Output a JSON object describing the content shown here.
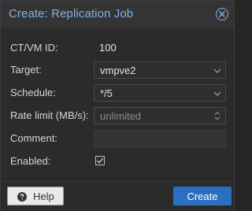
{
  "dialog": {
    "title": "Create: Replication Job",
    "close_icon": "close-circle-icon",
    "accent_color": "#7fb2e6"
  },
  "form": {
    "vmid": {
      "label": "CT/VM ID:",
      "value": "100"
    },
    "target": {
      "label": "Target:",
      "value": "vmpve2",
      "icon": "chevron-down-icon"
    },
    "schedule": {
      "label": "Schedule:",
      "value": "*/5",
      "icon": "chevron-down-icon"
    },
    "rate": {
      "label": "Rate limit (MB/s):",
      "placeholder": "unlimited",
      "icon": "spinner-updown-icon"
    },
    "comment": {
      "label": "Comment:",
      "value": ""
    },
    "enabled": {
      "label": "Enabled:",
      "checked": true
    }
  },
  "footer": {
    "help_label": "Help",
    "help_icon": "question-circle-icon",
    "create_label": "Create",
    "create_color": "#2a6fc0"
  }
}
